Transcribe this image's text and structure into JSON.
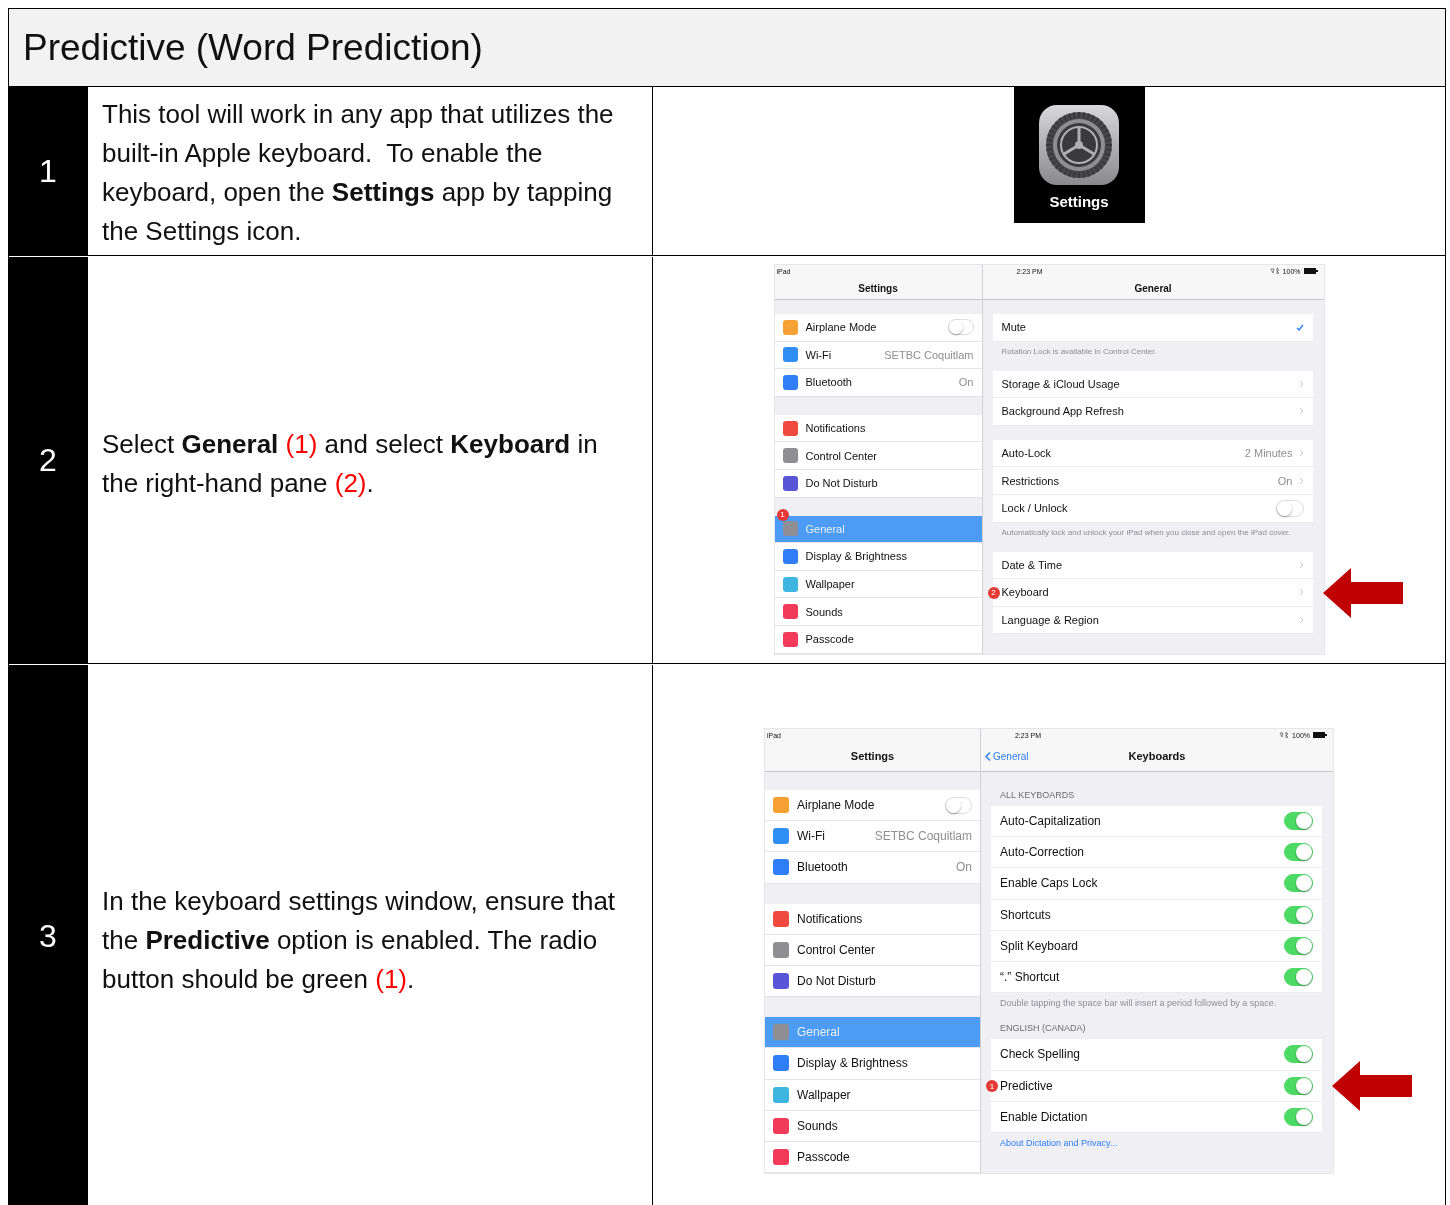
{
  "title": "Predictive (Word Prediction)",
  "steps": [
    {
      "number": "1",
      "instruction": [
        {
          "kind": "plain",
          "text": "This tool will work in any app that utilizes the built-in Apple keyboard.  To enable the keyboard, open the **Settings** app by tapping the Settings icon."
        }
      ],
      "visual": {
        "kind": "app_icon",
        "label": "Settings"
      }
    },
    {
      "number": "2",
      "instruction": [
        {
          "kind": "plain",
          "text": "Select **General** "
        },
        {
          "kind": "callout",
          "text": "(1)"
        },
        {
          "kind": "plain",
          "text": " and select **Keyboard** in the right-hand pane "
        },
        {
          "kind": "callout",
          "text": "(2)"
        },
        {
          "kind": "plain",
          "text": "."
        }
      ],
      "visual": {
        "kind": "ipad_screenshot",
        "status": {
          "device": "iPad",
          "time": "2:23 PM",
          "battery": "100%"
        },
        "sidebar": {
          "title": "Settings",
          "groups": [
            [
              {
                "label": "Airplane Mode",
                "color": "#f7a033",
                "kind": "toggle",
                "on": false,
                "selected": false
              },
              {
                "label": "Wi-Fi",
                "value": "SETBC Coquitlam",
                "color": "#2f8ff5",
                "selected": false
              },
              {
                "label": "Bluetooth",
                "value": "On",
                "color": "#2f7ef5",
                "selected": false
              }
            ],
            [
              {
                "label": "Notifications",
                "color": "#f04a3e",
                "selected": false
              },
              {
                "label": "Control Center",
                "color": "#8e8e93",
                "selected": false
              },
              {
                "label": "Do Not Disturb",
                "color": "#5856d6",
                "selected": false
              }
            ],
            [
              {
                "label": "General",
                "color": "#8e8e93",
                "selected": true,
                "badge": "1"
              },
              {
                "label": "Display & Brightness",
                "color": "#2f7ef5",
                "selected": false
              },
              {
                "label": "Wallpaper",
                "color": "#3fb6e0",
                "selected": false
              },
              {
                "label": "Sounds",
                "color": "#f23a5a",
                "selected": false
              },
              {
                "label": "Passcode",
                "color": "#f23a5a",
                "selected": false
              }
            ]
          ]
        },
        "detail": {
          "title": "General",
          "sections": [
            {
              "rows": [
                {
                  "label": "Mute",
                  "kind": "check"
                }
              ],
              "footer": {
                "kind": "note",
                "text": "Rotation Lock is available in Control Center."
              }
            },
            {
              "rows": [
                {
                  "label": "Storage & iCloud Usage",
                  "kind": "chevron"
                },
                {
                  "label": "Background App Refresh",
                  "kind": "chevron"
                }
              ]
            },
            {
              "rows": [
                {
                  "label": "Auto-Lock",
                  "value": "2 Minutes",
                  "kind": "chevron"
                },
                {
                  "label": "Restrictions",
                  "value": "On",
                  "kind": "chevron"
                },
                {
                  "label": "Lock / Unlock",
                  "kind": "toggle",
                  "on": false
                }
              ],
              "footer": {
                "kind": "note",
                "text": "Automatically lock and unlock your iPad when you close and open the iPad cover."
              }
            },
            {
              "rows": [
                {
                  "label": "Date & Time",
                  "kind": "chevron"
                },
                {
                  "label": "Keyboard",
                  "kind": "chevron",
                  "badge": "2",
                  "pointer": true
                },
                {
                  "label": "Language & Region",
                  "kind": "chevron"
                }
              ]
            }
          ]
        }
      }
    },
    {
      "number": "3",
      "instruction": [
        {
          "kind": "plain",
          "text": "In the keyboard settings window, ensure that the **Predictive** option is enabled. The radio button should be green "
        },
        {
          "kind": "callout",
          "text": "(1)"
        },
        {
          "kind": "plain",
          "text": "."
        }
      ],
      "visual": {
        "kind": "ipad_screenshot",
        "status": {
          "device": "iPad",
          "time": "2:23 PM",
          "battery": "100%"
        },
        "sidebar": {
          "title": "Settings",
          "groups": [
            [
              {
                "label": "Airplane Mode",
                "color": "#f7a033",
                "kind": "toggle",
                "on": false,
                "selected": false
              },
              {
                "label": "Wi-Fi",
                "value": "SETBC Coquitlam",
                "color": "#2f8ff5",
                "selected": false
              },
              {
                "label": "Bluetooth",
                "value": "On",
                "color": "#2f7ef5",
                "selected": false
              }
            ],
            [
              {
                "label": "Notifications",
                "color": "#f04a3e",
                "selected": false
              },
              {
                "label": "Control Center",
                "color": "#8e8e93",
                "selected": false
              },
              {
                "label": "Do Not Disturb",
                "color": "#5856d6",
                "selected": false
              }
            ],
            [
              {
                "label": "General",
                "color": "#8e8e93",
                "selected": true
              },
              {
                "label": "Display & Brightness",
                "color": "#2f7ef5",
                "selected": false
              },
              {
                "label": "Wallpaper",
                "color": "#3fb6e0",
                "selected": false
              },
              {
                "label": "Sounds",
                "color": "#f23a5a",
                "selected": false
              },
              {
                "label": "Passcode",
                "color": "#f23a5a",
                "selected": false
              }
            ]
          ]
        },
        "detail": {
          "back": "General",
          "title": "Keyboards",
          "sections": [
            {
              "header": "ALL KEYBOARDS",
              "rows": [
                {
                  "label": "Auto-Capitalization",
                  "kind": "toggle",
                  "on": true
                },
                {
                  "label": "Auto-Correction",
                  "kind": "toggle",
                  "on": true
                },
                {
                  "label": "Enable Caps Lock",
                  "kind": "toggle",
                  "on": true
                },
                {
                  "label": "Shortcuts",
                  "kind": "toggle",
                  "on": true
                },
                {
                  "label": "Split Keyboard",
                  "kind": "toggle",
                  "on": true
                },
                {
                  "label": "“.” Shortcut",
                  "kind": "toggle",
                  "on": true
                }
              ],
              "footer": {
                "kind": "note",
                "text": "Double tapping the space bar will insert a period followed by a space."
              }
            },
            {
              "header": "ENGLISH (CANADA)",
              "rows": [
                {
                  "label": "Check Spelling",
                  "kind": "toggle",
                  "on": true
                },
                {
                  "label": "Predictive",
                  "kind": "toggle",
                  "on": true,
                  "badge": "1",
                  "pointer": true
                },
                {
                  "label": "Enable Dictation",
                  "kind": "toggle",
                  "on": true
                }
              ],
              "footer": {
                "kind": "link",
                "text": "About Dictation and Privacy..."
              }
            }
          ]
        }
      }
    }
  ]
}
